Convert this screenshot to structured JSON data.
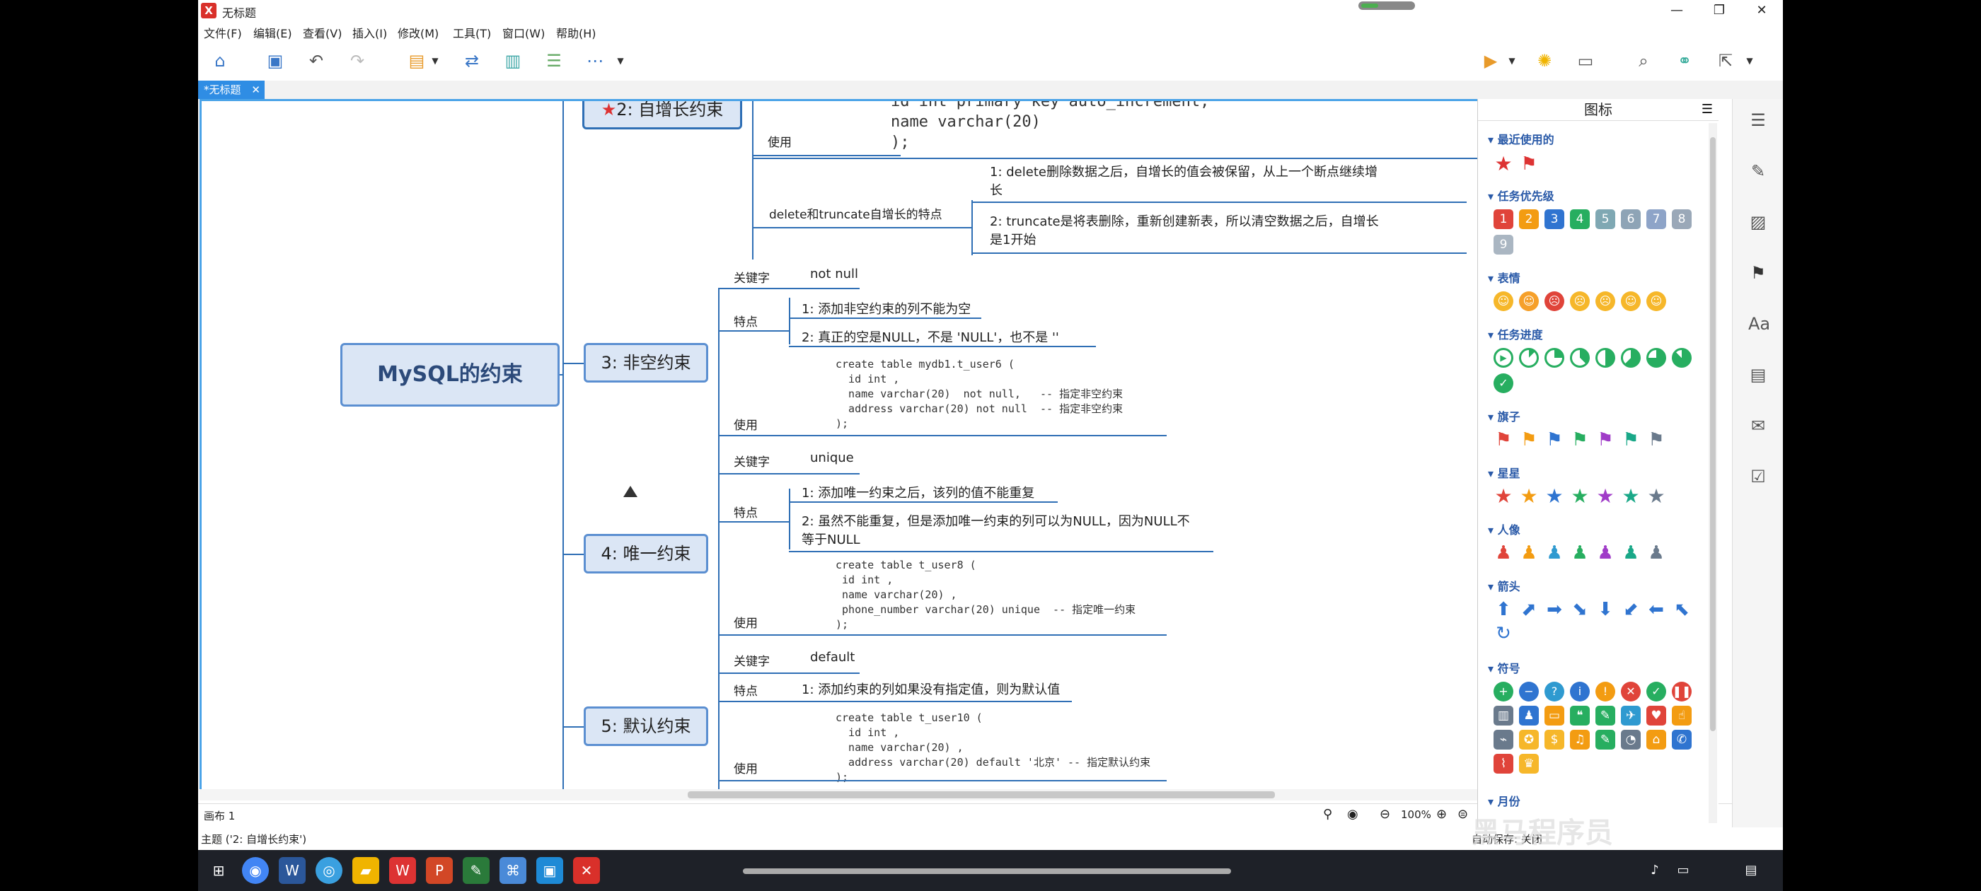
{
  "window": {
    "title": "无标题",
    "logo": "X"
  },
  "menu": [
    "文件(F)",
    "编辑(E)",
    "查看(V)",
    "插入(I)",
    "修改(M)",
    "工具(T)",
    "窗口(W)",
    "帮助(H)"
  ],
  "tab": {
    "label": "*无标题",
    "close": "✕"
  },
  "mindmap": {
    "root": "MySQL的约束",
    "branch2": {
      "title": "2: 自增长约束",
      "use_label": "使用",
      "code": [
        "id int primary key auto_increment,",
        "name varchar(20)",
        ");"
      ],
      "feature_label": "delete和truncate自增长的特点",
      "points": [
        "1: delete删除数据之后，自增长的值会被保留，从上一个断点继续增",
        "长",
        "2: truncate是将表删除，重新创建新表，所以清空数据之后，自增长",
        "是1开始"
      ]
    },
    "branch3": {
      "title": "3: 非空约束",
      "keyword_label": "关键字",
      "keyword": "not null",
      "feature_label": "特点",
      "points": [
        "1: 添加非空约束的列不能为空",
        "2: 真正的空是NULL，不是 'NULL'，也不是 ''"
      ],
      "use_label": "使用",
      "code": [
        "create table mydb1.t_user6 (",
        "  id int ,",
        "  name varchar(20)  not null,   -- 指定非空约束",
        "  address varchar(20) not null  -- 指定非空约束",
        ");"
      ]
    },
    "branch4": {
      "title": "4: 唯一约束",
      "keyword_label": "关键字",
      "keyword": "unique",
      "feature_label": "特点",
      "points": [
        "1: 添加唯一约束之后，该列的值不能重复",
        "2: 虽然不能重复，但是添加唯一约束的列可以为NULL，因为NULL不",
        "等于NULL"
      ],
      "use_label": "使用",
      "code": [
        "create table t_user8 (",
        " id int ,",
        " name varchar(20) ,",
        " phone_number varchar(20) unique  -- 指定唯一约束",
        ");"
      ]
    },
    "branch5": {
      "title": "5: 默认约束",
      "keyword_label": "关键字",
      "keyword": "default",
      "feature_label": "特点",
      "points": [
        "1: 添加约束的列如果没有指定值，则为默认值"
      ],
      "use_label": "使用",
      "code": [
        "create table t_user10 (",
        "  id int ,",
        "  name varchar(20) ,",
        "  address varchar(20) default '北京' -- 指定默认约束",
        ");"
      ]
    }
  },
  "panel": {
    "title": "图标",
    "sections": [
      "最近使用的",
      "任务优先级",
      "表情",
      "任务进度",
      "旗子",
      "星星",
      "人像",
      "箭头",
      "符号",
      "月份"
    ],
    "priority": [
      "1",
      "2",
      "3",
      "4",
      "5",
      "6",
      "7",
      "8",
      "9"
    ]
  },
  "status": {
    "canvas": "画布 1",
    "zoom": "100%",
    "topic": "主题 ('2: 自增长约束')",
    "autosave": "自动保存: 关闭"
  },
  "watermark": "黑马程序员"
}
